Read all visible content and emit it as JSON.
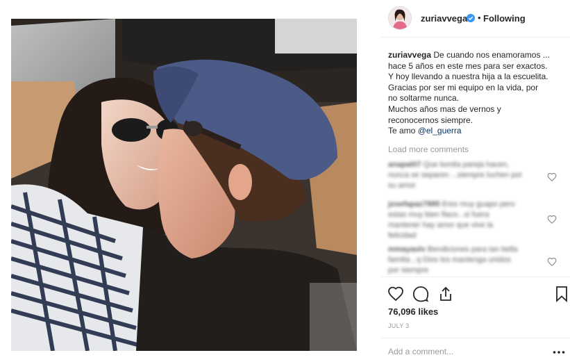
{
  "post": {
    "image_alt": "Selfie of a couple kissing inside a car",
    "header": {
      "username": "zuriavvega",
      "verified": true,
      "separator": "•",
      "follow_state": "Following"
    },
    "caption": {
      "username": "zuriavvega",
      "lines": [
        "De cuando nos enamoramos ...",
        "hace 5 años en este mes para ser exactos.",
        "Y hoy llevando a nuestra hija a la escuelita.",
        "Gracias por ser mi equipo en la vida, por",
        "no soltarme nunca.",
        "Muchos años mas de vernos y",
        "reconocernos siempre.",
        "Te amo"
      ],
      "mention": "@el_guerra"
    },
    "load_more_label": "Load more comments",
    "comments": [
      {
        "user": "anapat07",
        "lines": [
          "Que bonita pareja hacen,",
          "nunca se separen ...siempre luchen por",
          "su amor"
        ]
      },
      {
        "user": "josefapaz7885",
        "lines": [
          "Eres muy guapo pero",
          "estas muy bien flaco...si fuera ",
          "mantener hay amor que vive la",
          "felicidad"
        ]
      },
      {
        "user": "mmayaolv",
        "lines": [
          "Bendiciones para tan bella",
          "familia , q Dios los mantenga unidos",
          "por siempre"
        ]
      }
    ],
    "likes": "76,096 likes",
    "date": "JULY 3",
    "add_comment_placeholder": "Add a comment...",
    "icons": {
      "like": "heart-icon",
      "comment": "speech-bubble-icon",
      "share": "share-icon",
      "save": "bookmark-icon",
      "more": "ellipsis-icon"
    },
    "colors": {
      "verified": "#3897f0",
      "mention": "#003569",
      "muted": "#999999",
      "text": "#262626"
    }
  }
}
